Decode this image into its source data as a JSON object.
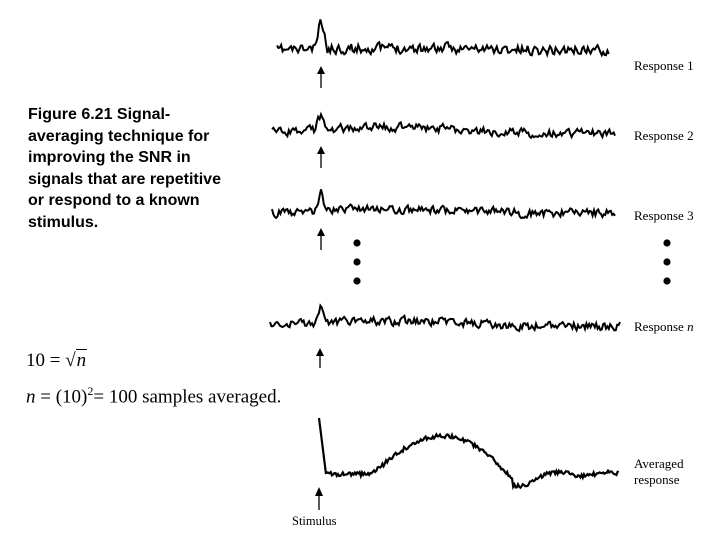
{
  "caption": "Figure 6.21 Signal-averaging technique for improving the SNR in signals that are repetitive or respond to a known stimulus.",
  "equations": {
    "eq1": {
      "lhs": "10 =",
      "radicand": "n"
    },
    "eq2": {
      "var": "n",
      "mid": " = (10)",
      "exp": "2",
      "rhs": "= 100 samples averaged."
    }
  },
  "traces": [
    {
      "id": "response-1",
      "label": "Response 1",
      "label_italic_suffix": ""
    },
    {
      "id": "response-2",
      "label": "Response 2",
      "label_italic_suffix": ""
    },
    {
      "id": "response-3",
      "label": "Response 3",
      "label_italic_suffix": ""
    },
    {
      "id": "response-n",
      "label": "Response ",
      "label_italic_suffix": "n"
    },
    {
      "id": "averaged-response",
      "label_line1": "Averaged",
      "label_line2": "response"
    }
  ],
  "stimulus_label": "Stimulus",
  "ellipsis_marker": "⋮"
}
